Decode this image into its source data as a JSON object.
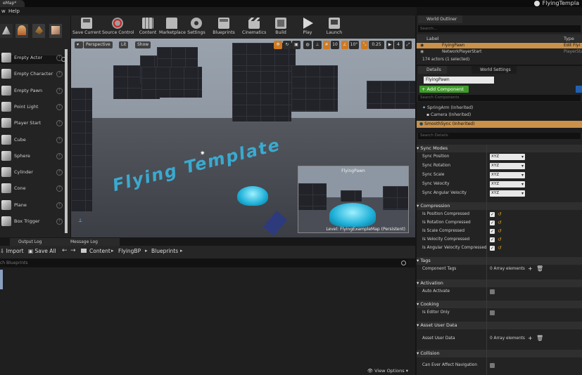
{
  "window": {
    "tab_title": "eMap*",
    "project_title": "FlyingTempla"
  },
  "menu": {
    "items": [
      "w",
      "Help"
    ]
  },
  "left_panel": {
    "search_placeholder": "",
    "place_items": [
      {
        "label": "Empty Actor"
      },
      {
        "label": "Empty Character"
      },
      {
        "label": "Empty Pawn"
      },
      {
        "label": "Point Light"
      },
      {
        "label": "Player Start"
      },
      {
        "label": "Cube"
      },
      {
        "label": "Sphere"
      },
      {
        "label": "Cylinder"
      },
      {
        "label": "Cone"
      },
      {
        "label": "Plane"
      },
      {
        "label": "Box Trigger"
      }
    ]
  },
  "toolbar": {
    "buttons": [
      {
        "label": "Save Current"
      },
      {
        "label": "Source Control"
      },
      {
        "label": "Content"
      },
      {
        "label": "Marketplace"
      },
      {
        "label": "Settings"
      },
      {
        "label": "Blueprints"
      },
      {
        "label": "Cinematics"
      },
      {
        "label": "Build"
      },
      {
        "label": "Play"
      },
      {
        "label": "Launch"
      }
    ]
  },
  "viewport": {
    "perspective_label": "Perspective",
    "lit_label": "Lit",
    "show_label": "Show",
    "grid_snap": "10",
    "rotation_snap": "10°",
    "scale_snap": "0.25",
    "camera_speed": "4",
    "overlay_text": "Flying Template",
    "pip_title": "FlyingPawn",
    "pip_caption": "Level:  FlyingExampleMap (Persistent)"
  },
  "bottom": {
    "tabs": [
      "Output Log",
      "Message Log"
    ],
    "import_label": "Import",
    "save_all_label": "Save All",
    "breadcrumb": [
      "Content",
      "FlyingBP",
      "Blueprints"
    ],
    "search_placeholder": "ch Blueprints",
    "view_options": "View Options"
  },
  "outliner": {
    "tab": "World Outliner",
    "search_placeholder": "Search...",
    "col_label": "Label",
    "col_type": "Type",
    "rows": [
      {
        "label": "FlyingPawn",
        "type": "Edit Flyi"
      },
      {
        "label": "NetworkPlayerStart",
        "type": "PlayerSta"
      }
    ],
    "status": "174 actors (1 selected)"
  },
  "details": {
    "tabs": [
      "Details",
      "World Settings"
    ],
    "name_value": "FlyingPawn",
    "add_component_label": "+ Add Component",
    "components_search_placeholder": "Search Components",
    "components": [
      "SpringArm (Inherited)",
      "Camera (Inherited)",
      "SmoothSync (Inherited)"
    ],
    "search_details_placeholder": "Search Details",
    "sync_modes": {
      "header": "Sync Modes",
      "rows": [
        {
          "name": "Sync Position",
          "value": "XYZ"
        },
        {
          "name": "Sync Rotation",
          "value": "XYZ"
        },
        {
          "name": "Sync Scale",
          "value": "XYZ"
        },
        {
          "name": "Sync Velocity",
          "value": "XYZ"
        },
        {
          "name": "Sync Angular Velocity",
          "value": "XYZ"
        }
      ]
    },
    "compression": {
      "header": "Compression",
      "rows": [
        {
          "name": "Is Position Compressed",
          "checked": true
        },
        {
          "name": "Is Rotation Compressed",
          "checked": true
        },
        {
          "name": "Is Scale Compressed",
          "checked": true
        },
        {
          "name": "Is Velocity Compressed",
          "checked": true
        },
        {
          "name": "Is Angular Velocity Compressed",
          "checked": true
        }
      ]
    },
    "tags": {
      "header": "Tags",
      "row_name": "Component Tags",
      "row_value": "0 Array elements"
    },
    "activation": {
      "header": "Activation",
      "row_name": "Auto Activate"
    },
    "cooking": {
      "header": "Cooking",
      "row_name": "Is Editor Only"
    },
    "asset_user_data": {
      "header": "Asset User Data",
      "row_name": "Asset User Data",
      "row_value": "0 Array elements"
    },
    "collision": {
      "header": "Collision",
      "row_name": "Can Ever Affect Navigation"
    }
  },
  "colors": {
    "accent_orange": "#d07920",
    "selected_row": "#c9914a",
    "add_component_green": "#3f9a2a",
    "template_text_blue": "#3aaad0"
  }
}
